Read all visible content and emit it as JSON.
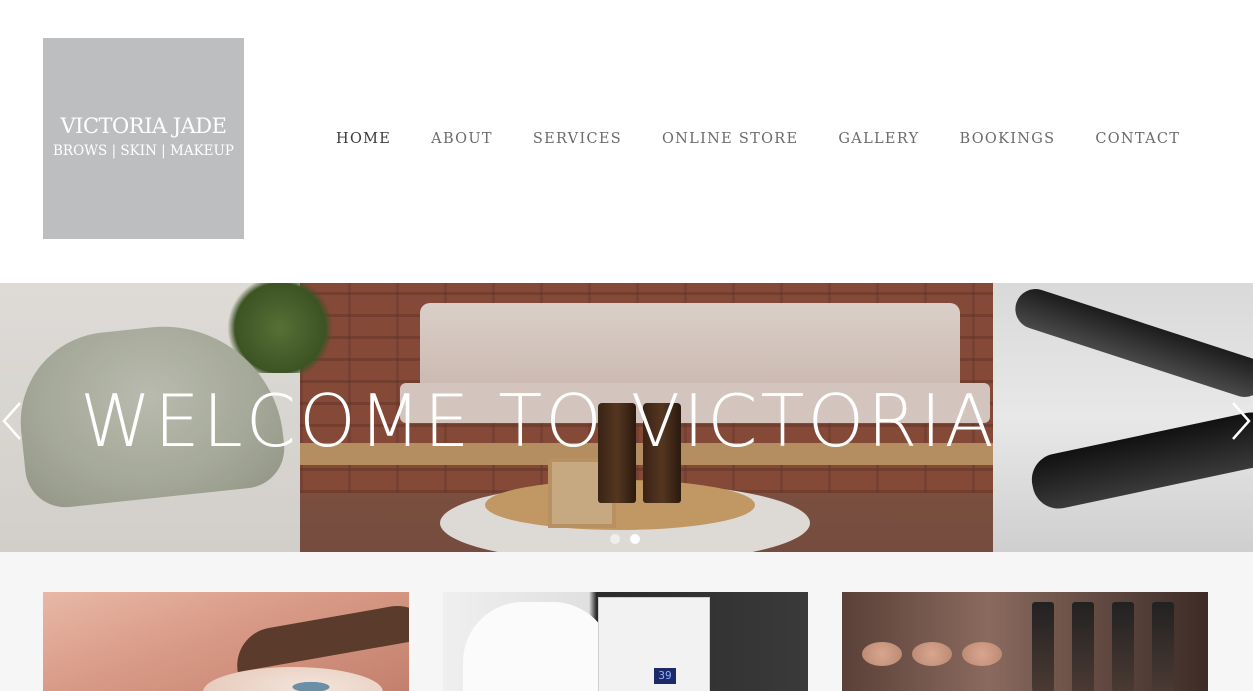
{
  "logo": {
    "name": "VICTORIA JADE",
    "tagline": "BROWS | SKIN | MAKEUP"
  },
  "nav": {
    "items": [
      {
        "label": "HOME",
        "active": true
      },
      {
        "label": "ABOUT",
        "active": false
      },
      {
        "label": "SERVICES",
        "active": false
      },
      {
        "label": "ONLINE STORE",
        "active": false
      },
      {
        "label": "GALLERY",
        "active": false
      },
      {
        "label": "BOOKINGS",
        "active": false
      },
      {
        "label": "CONTACT",
        "active": false
      }
    ]
  },
  "hero": {
    "title": "WELCOME TO VICTORIA JADE",
    "slides_count": 2,
    "active_slide": 2,
    "prev_icon": "chevron-left-icon",
    "next_icon": "chevron-right-icon"
  },
  "cards": {
    "c2_screen": "39"
  },
  "colors": {
    "logo_bg": "#bdbec0",
    "nav_text": "#6b6b6b",
    "nav_active": "#3a3a3a",
    "content_bg": "#f6f6f6"
  }
}
